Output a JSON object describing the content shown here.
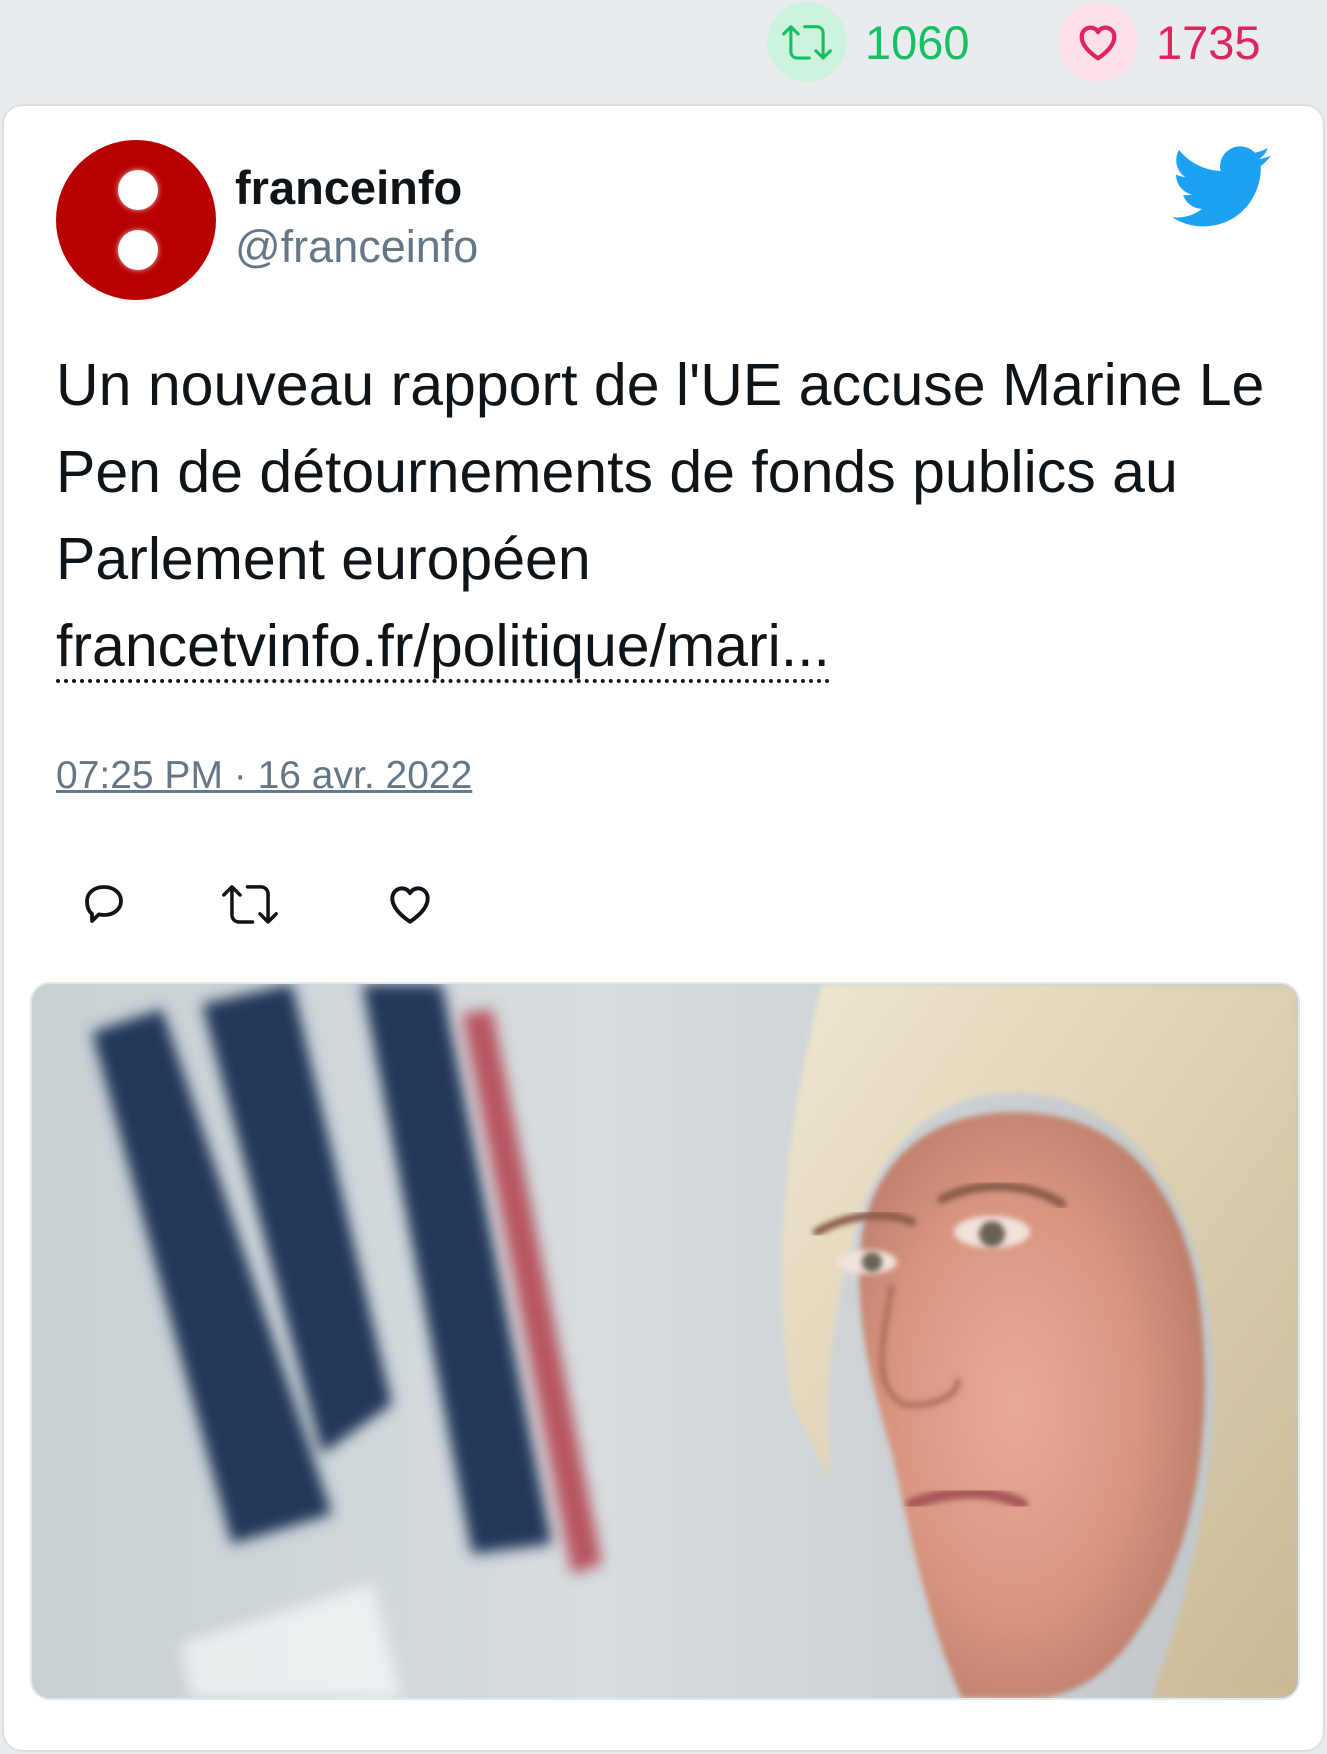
{
  "stats": {
    "retweets": "1060",
    "likes": "1735",
    "retweet_color": "#17bf63",
    "like_color": "#e0245e"
  },
  "tweet": {
    "author_name": "franceinfo",
    "author_handle": "@franceinfo",
    "text": "Un nouveau rapport de l'UE accuse Marine Le Pen de détournements de fonds publics au Parlement européen",
    "link_text": "francetvinfo.fr/politique/mari...",
    "timestamp": "07:25 PM · 16 avr. 2022"
  },
  "icons": {
    "brand": "twitter-bird-icon",
    "retweet": "retweet-icon",
    "like": "heart-icon",
    "reply": "reply-icon"
  },
  "colors": {
    "avatar_bg": "#b90000",
    "twitter_blue": "#1da1f2",
    "muted_text": "#657786"
  }
}
